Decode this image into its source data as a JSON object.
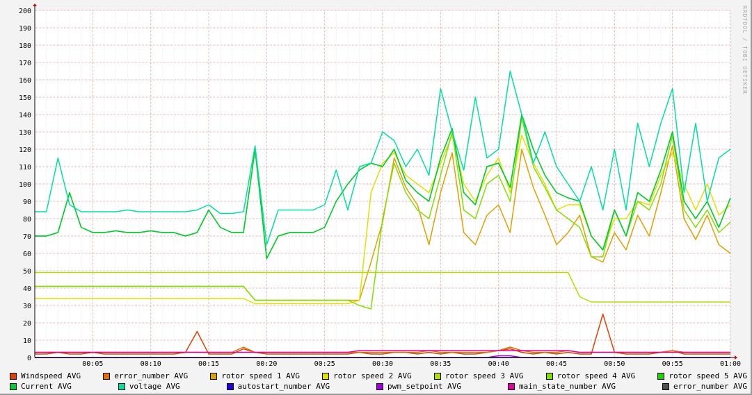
{
  "watermark": "RRDTOOL / TOBI OETIKER",
  "chart_data": {
    "type": "line",
    "title": "",
    "xlabel": "",
    "ylabel": "",
    "xlim_minutes": [
      0,
      60
    ],
    "ylim": [
      0,
      200
    ],
    "grid": true,
    "legend_placement": "bottom",
    "y_ticks": [
      0,
      10,
      20,
      30,
      40,
      50,
      60,
      70,
      80,
      90,
      100,
      110,
      120,
      130,
      140,
      150,
      160,
      170,
      180,
      190,
      200
    ],
    "x_ticks": [
      {
        "m": 5,
        "label": "00:05"
      },
      {
        "m": 10,
        "label": "00:10"
      },
      {
        "m": 15,
        "label": "00:15"
      },
      {
        "m": 20,
        "label": "00:20"
      },
      {
        "m": 25,
        "label": "00:25"
      },
      {
        "m": 30,
        "label": "00:30"
      },
      {
        "m": 35,
        "label": "00:35"
      },
      {
        "m": 40,
        "label": "00:40"
      },
      {
        "m": 45,
        "label": "00:45"
      },
      {
        "m": 50,
        "label": "00:50"
      },
      {
        "m": 55,
        "label": "00:55"
      },
      {
        "m": 60,
        "label": "01:00"
      }
    ],
    "series": [
      {
        "name": "Windspeed AVG",
        "color": "#e04000",
        "values": [
          2,
          2,
          3,
          2,
          2,
          3,
          2,
          2,
          2,
          2,
          2,
          2,
          2,
          3,
          15,
          2,
          2,
          2,
          5,
          3,
          2,
          2,
          2,
          2,
          2,
          2,
          2,
          2,
          3,
          2,
          2,
          3,
          3,
          2,
          3,
          2,
          3,
          2,
          2,
          3,
          4,
          5,
          3,
          2,
          3,
          2,
          3,
          2,
          2,
          25,
          3,
          2,
          2,
          2,
          3,
          4,
          2,
          2,
          2,
          2,
          2
        ]
      },
      {
        "name": "error_number AVG",
        "color": "#e07000",
        "values": [
          3,
          3,
          3,
          3,
          3,
          3,
          3,
          3,
          3,
          3,
          3,
          3,
          3,
          3,
          3,
          3,
          3,
          3,
          6,
          3,
          3,
          3,
          3,
          3,
          3,
          3,
          3,
          3,
          3,
          3,
          3,
          3,
          3,
          3,
          4,
          3,
          3,
          3,
          3,
          3,
          4,
          6,
          4,
          3,
          3,
          3,
          4,
          3,
          3,
          3,
          3,
          3,
          3,
          3,
          3,
          4,
          3,
          3,
          3,
          3,
          3
        ]
      },
      {
        "name": "rotor speed 1 AVG",
        "color": "#e0a000",
        "values": [
          41,
          41,
          41,
          41,
          41,
          41,
          41,
          41,
          41,
          41,
          41,
          41,
          41,
          41,
          41,
          41,
          41,
          41,
          41,
          33,
          33,
          33,
          33,
          33,
          33,
          33,
          33,
          33,
          33,
          55,
          78,
          115,
          98,
          88,
          65,
          95,
          118,
          72,
          65,
          82,
          88,
          72,
          120,
          98,
          82,
          65,
          72,
          82,
          58,
          55,
          72,
          62,
          82,
          70,
          95,
          122,
          80,
          68,
          82,
          65,
          60
        ]
      },
      {
        "name": "rotor speed 2 AVG",
        "color": "#e0e000",
        "values": [
          34,
          34,
          34,
          34,
          34,
          34,
          34,
          34,
          34,
          34,
          34,
          34,
          34,
          34,
          34,
          34,
          34,
          34,
          34,
          31,
          31,
          31,
          31,
          31,
          31,
          31,
          31,
          31,
          33,
          95,
          112,
          118,
          105,
          100,
          95,
          112,
          128,
          100,
          90,
          105,
          115,
          95,
          128,
          112,
          100,
          85,
          88,
          88,
          70,
          62,
          80,
          80,
          90,
          88,
          105,
          118,
          100,
          85,
          100,
          82,
          88
        ]
      },
      {
        "name": "rotor speed 3 AVG",
        "color": "#b0e000",
        "values": [
          49,
          49,
          49,
          49,
          49,
          49,
          49,
          49,
          49,
          49,
          49,
          49,
          49,
          49,
          49,
          49,
          49,
          49,
          49,
          49,
          49,
          49,
          49,
          49,
          49,
          49,
          49,
          49,
          49,
          49,
          49,
          49,
          49,
          49,
          49,
          49,
          49,
          49,
          49,
          49,
          49,
          49,
          49,
          49,
          49,
          49,
          49,
          35,
          32,
          32,
          32,
          32,
          32,
          32,
          32,
          32,
          32,
          32,
          32,
          32,
          32
        ]
      },
      {
        "name": "rotor speed 4 AVG",
        "color": "#80e000",
        "values": [
          41,
          41,
          41,
          41,
          41,
          41,
          41,
          41,
          41,
          41,
          41,
          41,
          41,
          41,
          41,
          41,
          41,
          41,
          41,
          33,
          33,
          33,
          33,
          33,
          33,
          33,
          33,
          33,
          30,
          28,
          80,
          112,
          95,
          85,
          80,
          105,
          130,
          85,
          80,
          100,
          105,
          90,
          138,
          110,
          98,
          85,
          80,
          75,
          58,
          58,
          85,
          70,
          90,
          85,
          100,
          128,
          85,
          75,
          85,
          72,
          78
        ]
      },
      {
        "name": "rotor speed 5 AVG",
        "color": "#20d000",
        "values": [
          70,
          70,
          72,
          95,
          75,
          72,
          72,
          73,
          72,
          72,
          73,
          72,
          72,
          70,
          72,
          85,
          75,
          72,
          72,
          120,
          57,
          70,
          72,
          72,
          72,
          75,
          90,
          100,
          108,
          112,
          110,
          120,
          102,
          95,
          90,
          115,
          132,
          95,
          88,
          110,
          112,
          98,
          140,
          120,
          105,
          95,
          92,
          90,
          70,
          62,
          85,
          70,
          95,
          90,
          108,
          130,
          90,
          80,
          90,
          75,
          92
        ]
      },
      {
        "name": "Current AVG",
        "color": "#00cc33",
        "values": [
          70,
          70,
          72,
          95,
          75,
          72,
          72,
          73,
          72,
          72,
          73,
          72,
          72,
          70,
          72,
          85,
          75,
          72,
          72,
          120,
          57,
          70,
          72,
          72,
          72,
          75,
          90,
          100,
          108,
          112,
          110,
          120,
          102,
          95,
          90,
          115,
          132,
          95,
          88,
          110,
          112,
          98,
          140,
          120,
          105,
          95,
          92,
          90,
          70,
          62,
          85,
          70,
          95,
          90,
          108,
          130,
          90,
          80,
          90,
          75,
          92
        ]
      },
      {
        "name": "voltage AVG",
        "color": "#00e0a0",
        "values": [
          84,
          84,
          115,
          88,
          84,
          84,
          84,
          84,
          85,
          84,
          84,
          84,
          84,
          84,
          85,
          88,
          83,
          83,
          84,
          122,
          65,
          85,
          85,
          85,
          85,
          88,
          108,
          85,
          110,
          112,
          130,
          125,
          110,
          120,
          105,
          155,
          130,
          108,
          150,
          115,
          120,
          165,
          140,
          112,
          130,
          110,
          100,
          90,
          110,
          85,
          120,
          85,
          135,
          110,
          135,
          155,
          95,
          135,
          90,
          115,
          120
        ]
      },
      {
        "name": "autostart_number AVG",
        "color": "#2000e0",
        "values": [
          0,
          0,
          0,
          0,
          0,
          0,
          0,
          0,
          0,
          0,
          0,
          0,
          0,
          0,
          0,
          0,
          0,
          0,
          0,
          0,
          0,
          0,
          0,
          0,
          0,
          0,
          0,
          0,
          0,
          0,
          0,
          0,
          0,
          0,
          0,
          0,
          0,
          0,
          0,
          0,
          0,
          0,
          0,
          0,
          0,
          0,
          0,
          0,
          0,
          0,
          0,
          0,
          0,
          0,
          0,
          0,
          0,
          0,
          0,
          0,
          0
        ]
      },
      {
        "name": "pwm_setpoint AVG",
        "color": "#a000e0",
        "values": [
          0,
          0,
          0,
          0,
          0,
          0,
          0,
          0,
          0,
          0,
          0,
          0,
          0,
          0,
          0,
          0,
          0,
          0,
          0,
          0,
          0,
          0,
          0,
          0,
          0,
          0,
          0,
          0,
          0,
          0,
          0,
          0,
          0,
          0,
          0,
          0,
          0,
          0,
          0,
          0,
          1,
          1,
          0,
          0,
          0,
          0,
          0,
          0,
          0,
          0,
          0,
          0,
          0,
          0,
          0,
          0,
          0,
          0,
          0,
          0,
          0
        ]
      },
      {
        "name": "main_state_number AVG",
        "color": "#e000a0",
        "values": [
          3,
          3,
          3,
          3,
          3,
          3,
          3,
          3,
          3,
          3,
          3,
          3,
          3,
          3,
          3,
          3,
          3,
          3,
          3,
          3,
          3,
          3,
          3,
          3,
          3,
          3,
          3,
          3,
          4,
          4,
          4,
          4,
          4,
          4,
          4,
          4,
          4,
          4,
          4,
          4,
          4,
          4,
          4,
          4,
          4,
          4,
          4,
          3,
          3,
          3,
          3,
          3,
          3,
          3,
          3,
          3,
          3,
          3,
          3,
          3,
          3
        ]
      },
      {
        "name": "error_number AVG",
        "color": "#505050",
        "values": [
          0,
          0,
          0,
          0,
          0,
          0,
          0,
          0,
          0,
          0,
          0,
          0,
          0,
          0,
          0,
          0,
          0,
          0,
          0,
          0,
          0,
          0,
          0,
          0,
          0,
          0,
          0,
          0,
          0,
          0,
          0,
          0,
          0,
          0,
          0,
          0,
          0,
          0,
          0,
          0,
          0,
          0,
          0,
          0,
          0,
          0,
          0,
          0,
          0,
          0,
          0,
          0,
          0,
          0,
          0,
          0,
          0,
          0,
          0,
          0,
          0
        ]
      }
    ],
    "legend_rows": [
      [
        0,
        1,
        2,
        3,
        4,
        5,
        6
      ],
      [
        7,
        8,
        9,
        10,
        11,
        12
      ]
    ]
  }
}
